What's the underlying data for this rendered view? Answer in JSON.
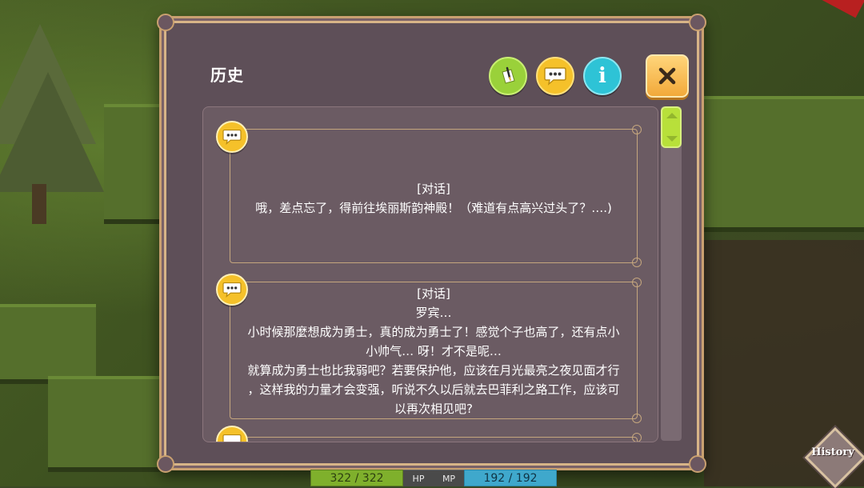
{
  "dialog": {
    "title": "历史",
    "close_icon": "close-icon",
    "buttons": [
      {
        "name": "quill-icon",
        "color": "#9ad13a"
      },
      {
        "name": "speech-bubble-icon",
        "color": "#f5c12a"
      },
      {
        "name": "info-icon",
        "color": "#2ec3d6",
        "glyph": "i"
      }
    ],
    "entries": [
      {
        "icon": "speech-bubble-icon",
        "tag": "[对话]",
        "lines": [
          "哦，差点忘了，得前往埃丽斯韵神殿！（难道有点高兴过头了？….)"
        ]
      },
      {
        "icon": "speech-bubble-icon",
        "tag": "[对话]",
        "lines": [
          "罗宾…",
          "小时候那麼想成为勇士，真的成为勇士了！感觉个子也高了，还有点小",
          "小帅气… 呀！才不是呢…",
          "就算成为勇士也比我弱吧？若要保护他，应该在月光最亮之夜见面才行",
          "，这样我的力量才会变强，听说不久以后就去巴菲利之路工作，应该可",
          "以再次相见吧?"
        ]
      }
    ]
  },
  "hud": {
    "hp_value": "322 / 322",
    "hp_label": "HP",
    "mp_label": "MP",
    "mp_value": "192 / 192"
  },
  "history_button": {
    "label": "History"
  },
  "colors": {
    "panel": "#5e4f58",
    "border": "#c9a070",
    "text": "#ffffff",
    "hp": "#7fb02c",
    "mp": "#3fa8cc"
  }
}
